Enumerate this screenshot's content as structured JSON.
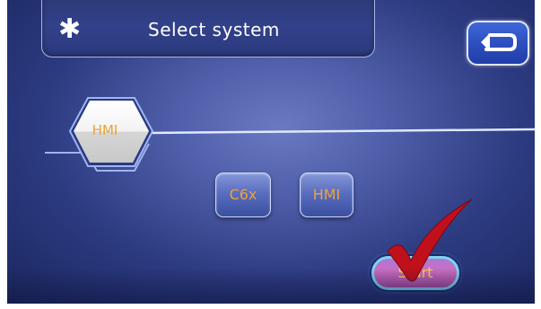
{
  "header": {
    "title": "Select system",
    "icon": "asterisk-icon"
  },
  "back_button": {
    "icon": "return-arrow-icon"
  },
  "selected_system": {
    "label": "HMI"
  },
  "options": [
    {
      "label": "C6x"
    },
    {
      "label": "HMI"
    }
  ],
  "start_button": {
    "label": "Start",
    "overlay_icon": "checkmark-icon"
  },
  "colors": {
    "background": "#3a4a96",
    "option_text": "#f0a23a",
    "start_text": "#ffd23a",
    "checkmark": "#c0101c"
  }
}
